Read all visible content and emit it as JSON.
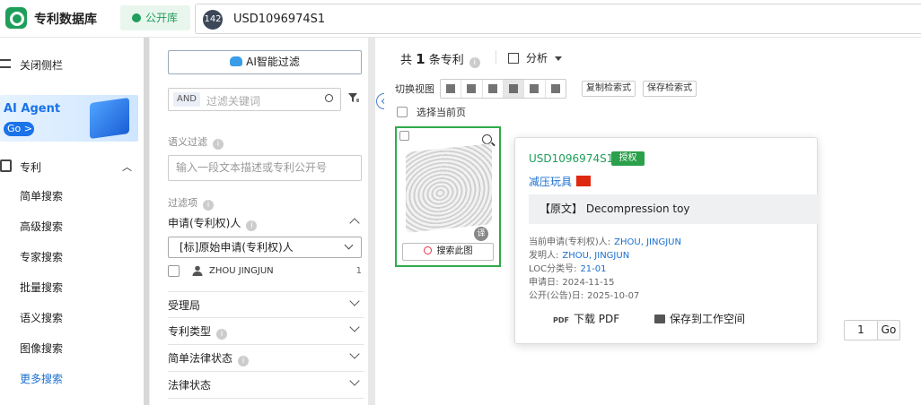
{
  "header": {
    "app_title": "专利数据库",
    "public_tab": "公开库",
    "result_badge": "142",
    "search_query": "USD1096974S1"
  },
  "sidebar": {
    "collapse_label": "关闭侧栏",
    "agent_title": "AI Agent",
    "agent_go": "Go >",
    "section_label": "专利",
    "items": [
      {
        "label": "简单搜索"
      },
      {
        "label": "高级搜索"
      },
      {
        "label": "专家搜索"
      },
      {
        "label": "批量搜索"
      },
      {
        "label": "语义搜索"
      },
      {
        "label": "图像搜索"
      },
      {
        "label": "更多搜索"
      }
    ]
  },
  "filter_panel": {
    "ai_filter_label": "AI智能过滤",
    "and_label": "AND",
    "keyword_placeholder": "过滤关键词",
    "semantic_label": "语义过滤",
    "semantic_placeholder": "输入一段文本描述或专利公开号",
    "filter_items_label": "过滤项",
    "applicant_section": "申请(专利权)人",
    "applicant_select": "[标]原始申请(专利权)人",
    "applicant_value": "ZHOU JINGJUN",
    "applicant_count": "1",
    "sections": [
      {
        "label": "受理局"
      },
      {
        "label": "专利类型"
      },
      {
        "label": "简单法律状态"
      },
      {
        "label": "法律状态"
      }
    ]
  },
  "results": {
    "count_prefix": "共",
    "count": "1",
    "count_suffix": "条专利",
    "analysis_label": "分析",
    "view_label": "切换视图",
    "copy_expression": "复制检索式",
    "save_expression": "保存检索式",
    "select_page": "选择当前页",
    "search_image": "搜索此图",
    "translate_badge": "译",
    "page_value": "1",
    "go_label": "Go"
  },
  "popup": {
    "pub_no": "USD1096974S1",
    "status": "授权",
    "title_cn": "减压玩具",
    "orig_label": "【原文】",
    "orig_title": "Decompression toy",
    "current_applicant_label": "当前申请(专利权)人:",
    "current_applicant": "ZHOU, JINGJUN",
    "inventor_label": "发明人:",
    "inventor": "ZHOU, JINGJUN",
    "loc_label": "LOC分类号:",
    "loc": "21-01",
    "filing_date_label": "申请日:",
    "filing_date": "2024-11-15",
    "pub_date_label": "公开(公告)日:",
    "pub_date": "2025-10-07",
    "download_pdf": "下载 PDF",
    "save_workspace": "保存到工作空间"
  },
  "colors": {
    "brand_green": "#1e9e5a",
    "link_blue": "#1a6fd1",
    "grant_green": "#2aa04a"
  }
}
